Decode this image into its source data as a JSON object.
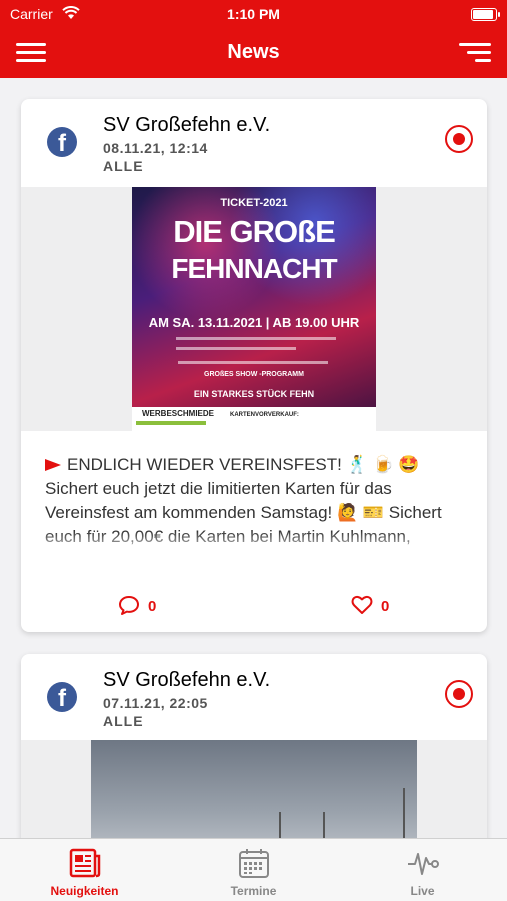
{
  "status_bar": {
    "carrier": "Carrier",
    "time": "1:10 PM"
  },
  "header": {
    "title": "News"
  },
  "posts": [
    {
      "author": "SV Großefehn e.V.",
      "date": "08.11.21, 12:14",
      "tag": "ALLE",
      "image_text": {
        "ticket": "TICKET-2021",
        "headline1": "DIE GROßE",
        "headline2": "FEHNNACHT",
        "date_line": "AM SA. 13.11.2021 | AB 19.00 UHR",
        "show": "GROßES SHOW -PROGRAMM",
        "slogan": "EIN STARKES STÜCK FEHN",
        "sponsor": "WERBESCHMIEDE",
        "presale": "KARTENVORVERKAUF:"
      },
      "text_line1": "ENDLICH WIEDER VEREINSFEST! 🕺 🍺 🤩",
      "text_line2": "Sichert euch jetzt die limitierten Karten für das Vereinsfest am kommenden Samstag! 🙋 🎫 Sichert euch für 20,00€ die Karten bei Martin Kuhlmann,",
      "comments": "0",
      "likes": "0"
    },
    {
      "author": "SV Großefehn e.V.",
      "date": "07.11.21, 22:05",
      "tag": "ALLE"
    }
  ],
  "tabs": [
    {
      "label": "Neuigkeiten",
      "icon": "newspaper-icon",
      "active": true
    },
    {
      "label": "Termine",
      "icon": "calendar-icon",
      "active": false
    },
    {
      "label": "Live",
      "icon": "pulse-icon",
      "active": false
    }
  ],
  "colors": {
    "accent": "#e3100f",
    "facebook": "#3b5998"
  }
}
